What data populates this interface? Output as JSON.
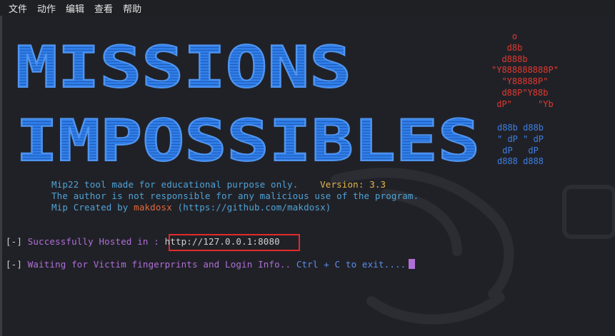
{
  "menubar": {
    "items": [
      "文件",
      "动作",
      "编辑",
      "查看",
      "帮助"
    ]
  },
  "banner": {
    "line1": "MISSIONS",
    "line2": "IMPOSSIBLES",
    "ascii_red": "    o\n   d8b\n  d888b\n\"Y888888888P\"\n  \"Y88888P\"\n  d88P\"Y88b\n dP\"     \"Yb",
    "ascii_blue": "d88b d88b\n\" dP \" dP\n dP   dP\nd888 d888"
  },
  "info": {
    "tool_desc": "Mip22 tool made for educational purpose only.",
    "version": "Version: 3.3",
    "disclaimer": "The author is not responsible for any malicious use of the program.",
    "created_prefix": "Mip Created by ",
    "author": "makdosx",
    "github": " (https://github.com/makdosx)"
  },
  "status": {
    "bracket": "[-]",
    "hosted_label": " Successfully Hosted in : ",
    "hosted_url": "http://127.0.0.1:8080",
    "waiting_label": " Waiting for Victim fingerprints and Login Info.. ",
    "exit_hint": "Ctrl + C to exit...."
  },
  "colors": {
    "banner_blue": "#2f7de8",
    "ascii_red": "#e0392f",
    "highlight_box": "#e22b2b",
    "status_purple": "#b06fd6"
  }
}
